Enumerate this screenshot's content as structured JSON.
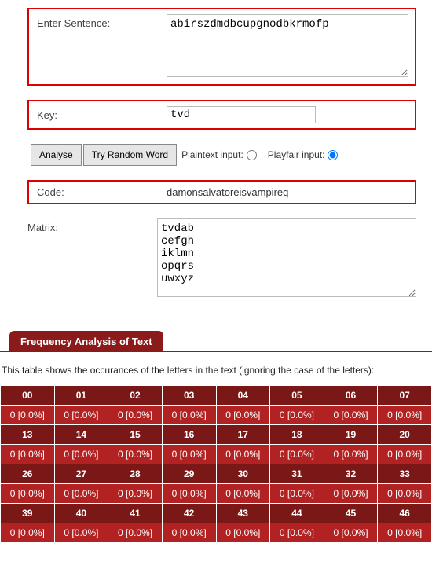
{
  "form": {
    "sentence_label": "Enter Sentence:",
    "sentence_value": "abirszdmdbcupgnodbkrmofp",
    "key_label": "Key:",
    "key_value": "tvd",
    "analyse_label": "Analyse",
    "random_label": "Try Random Word",
    "plaintext_label": "Plaintext input:",
    "playfair_label": "Playfair input:",
    "code_label": "Code:",
    "code_value": "damonsalvatoreisvampireq",
    "matrix_label": "Matrix:",
    "matrix_value": "tvdab\ncefgh\niklmn\nopqrs\nuwxyz"
  },
  "freq": {
    "header": "Frequency Analysis of Text",
    "desc": "This table shows the occurances of the letters in the text (ignoring the case of the letters):",
    "rows": [
      {
        "head": [
          "00",
          "01",
          "02",
          "03",
          "04",
          "05",
          "06",
          "07"
        ],
        "val": [
          "0 [0.0%]",
          "0 [0.0%]",
          "0 [0.0%]",
          "0 [0.0%]",
          "0 [0.0%]",
          "0 [0.0%]",
          "0 [0.0%]",
          "0 [0.0%]"
        ]
      },
      {
        "head": [
          "13",
          "14",
          "15",
          "16",
          "17",
          "18",
          "19",
          "20"
        ],
        "val": [
          "0 [0.0%]",
          "0 [0.0%]",
          "0 [0.0%]",
          "0 [0.0%]",
          "0 [0.0%]",
          "0 [0.0%]",
          "0 [0.0%]",
          "0 [0.0%]"
        ]
      },
      {
        "head": [
          "26",
          "27",
          "28",
          "29",
          "30",
          "31",
          "32",
          "33"
        ],
        "val": [
          "0 [0.0%]",
          "0 [0.0%]",
          "0 [0.0%]",
          "0 [0.0%]",
          "0 [0.0%]",
          "0 [0.0%]",
          "0 [0.0%]",
          "0 [0.0%]"
        ]
      },
      {
        "head": [
          "39",
          "40",
          "41",
          "42",
          "43",
          "44",
          "45",
          "46"
        ],
        "val": [
          "0 [0.0%]",
          "0 [0.0%]",
          "0 [0.0%]",
          "0 [0.0%]",
          "0 [0.0%]",
          "0 [0.0%]",
          "0 [0.0%]",
          "0 [0.0%]"
        ]
      }
    ]
  }
}
